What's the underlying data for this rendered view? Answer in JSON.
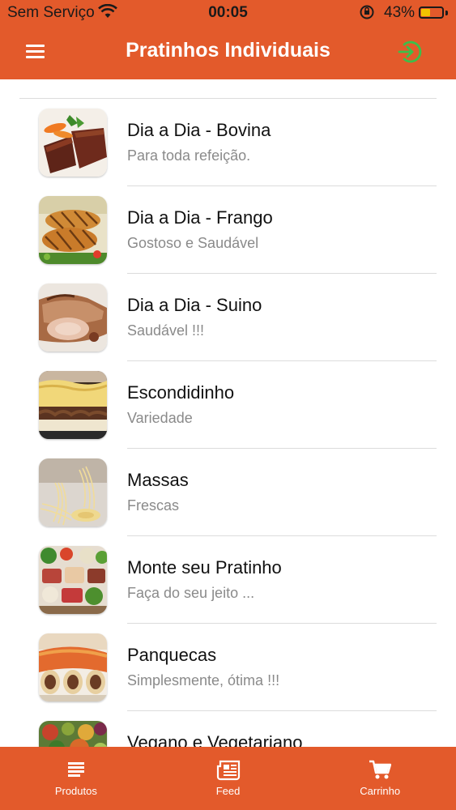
{
  "status_bar": {
    "carrier": "Sem Serviço",
    "wifi_icon": "wifi-icon",
    "time": "00:05",
    "lock_icon": "orientation-lock-icon",
    "battery_percent": "43%",
    "battery_level": 0.43
  },
  "app_bar": {
    "menu_icon": "hamburger-menu-icon",
    "title": "Pratinhos Individuais",
    "login_icon": "login-icon",
    "background_color": "#e35a2b",
    "login_icon_color": "#3cbf4a"
  },
  "items": [
    {
      "name": "Dia a Dia - Bovina",
      "description": "Para toda refeição.",
      "image": "beef-steak-photo"
    },
    {
      "name": "Dia a Dia - Frango",
      "description": "Gostoso e Saudável",
      "image": "grilled-chicken-photo"
    },
    {
      "name": "Dia a Dia - Suino",
      "description": "Saudável !!!",
      "image": "roast-pork-photo"
    },
    {
      "name": "Escondidinho",
      "description": "Variedade",
      "image": "escondidinho-photo"
    },
    {
      "name": "Massas",
      "description": "Frescas",
      "image": "fresh-pasta-photo"
    },
    {
      "name": "Monte seu Pratinho",
      "description": "Faça do seu jeito ...",
      "image": "food-platter-photo"
    },
    {
      "name": "Panquecas",
      "description": "Simplesmente, ótima !!!",
      "image": "pancakes-photo"
    },
    {
      "name": "Vegano e Vegetariano",
      "description": "",
      "image": "vegetables-photo"
    }
  ],
  "tab_bar": {
    "tabs": [
      {
        "label": "Produtos",
        "icon": "list-icon"
      },
      {
        "label": "Feed",
        "icon": "newspaper-icon"
      },
      {
        "label": "Carrinho",
        "icon": "cart-icon"
      }
    ]
  }
}
